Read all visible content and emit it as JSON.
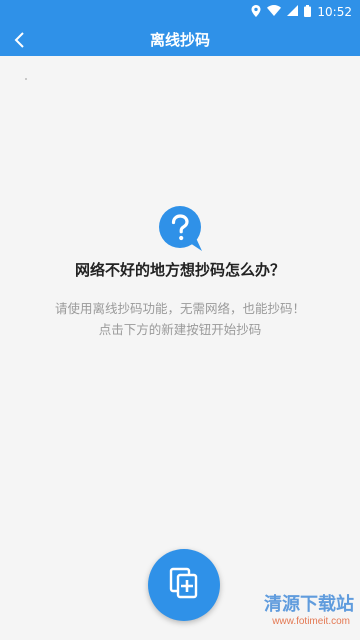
{
  "status_bar": {
    "time": "10:52",
    "icons": [
      "location-icon",
      "wifi-icon",
      "signal-icon",
      "battery-icon"
    ]
  },
  "app_bar": {
    "title": "离线抄码",
    "back_icon": "chevron-left-icon"
  },
  "empty_state": {
    "icon": "question-bubble-icon",
    "heading": "网络不好的地方想抄码怎么办？",
    "description_line1": "请使用离线抄码功能，无需网络，也能抄码！",
    "description_line2": "点击下方的新建按钮开始抄码"
  },
  "fab": {
    "icon": "add-copy-icon"
  },
  "watermark": {
    "text": "清源下载站",
    "url": "www.fotimeit.com"
  },
  "colors": {
    "primary": "#2f91e8",
    "background": "#f5f5f5",
    "heading": "#222222",
    "muted": "#9a9a9a"
  }
}
